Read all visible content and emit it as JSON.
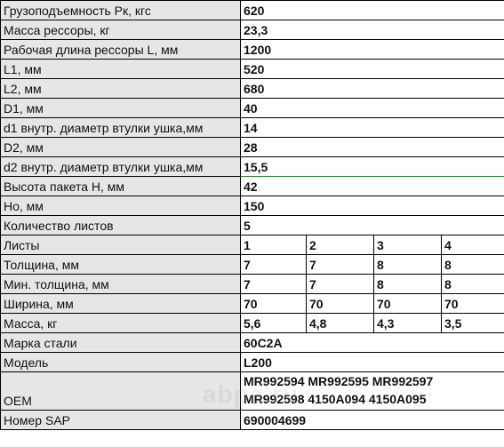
{
  "rows": [
    {
      "label": "Грузоподъемность Рк, кгс",
      "value": "620"
    },
    {
      "label": "Масса рессоры, кг",
      "value": "23,3"
    },
    {
      "label": "Рабочая длина рессоры L, мм",
      "value": "1200"
    },
    {
      "label": "L1, мм",
      "value": "520"
    },
    {
      "label": "L2, мм",
      "value": "680"
    },
    {
      "label": "D1, мм",
      "value": "40"
    },
    {
      "label": "d1 внутр. диаметр втулки ушка,мм",
      "value": "14"
    },
    {
      "label": "D2, мм",
      "value": "28"
    },
    {
      "label": "d2 внутр. диаметр втулки ушка,мм",
      "value": "15,5"
    },
    {
      "label": "Высота пакета H, мм",
      "value": "42"
    },
    {
      "label": "Но, мм",
      "value": "150"
    },
    {
      "label": "Количество листов",
      "value": "5"
    }
  ],
  "leaves": [
    {
      "label": "Листы",
      "values": [
        "1",
        "2",
        "3",
        "4"
      ]
    },
    {
      "label": "Толщина, мм",
      "values": [
        "7",
        "7",
        "8",
        "8"
      ]
    },
    {
      "label": "Мин. толщина, мм",
      "values": [
        "7",
        "7",
        "8",
        "8"
      ]
    },
    {
      "label": "Ширина, мм",
      "values": [
        "70",
        "70",
        "70",
        "70"
      ]
    },
    {
      "label": "Масса, кг",
      "values": [
        "5,6",
        "4,8",
        "4,3",
        "3,5"
      ]
    }
  ],
  "steel": {
    "label": "Марка стали",
    "value": "60С2А"
  },
  "model": {
    "label": "Модель",
    "value": "L200"
  },
  "oem": {
    "label": "OEM",
    "line1": "MR992594  MR992595  MR992597",
    "line2": "MR992598  4150A094  4150A095"
  },
  "sap": {
    "label": "Номер SAP",
    "value": "690004699"
  },
  "watermark": "abpa.ru",
  "colors": {
    "label_bg": "#e6e6e6",
    "value_bg": "#ffffff",
    "border": "#000000",
    "highlight_line": "#2e7d32"
  }
}
